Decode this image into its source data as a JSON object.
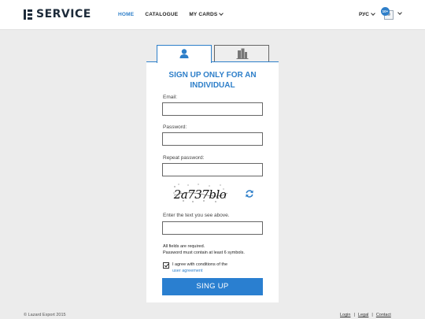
{
  "brand": {
    "name": "SERVICE",
    "logo_icon": "brand-e-logo-icon"
  },
  "nav": {
    "home": "HOME",
    "catalogue": "CATALOGUE",
    "my_cards": "MY CARDS"
  },
  "header": {
    "language": "РУС",
    "user_badge": "10+"
  },
  "tabs": {
    "individual_icon": "person-icon",
    "company_icon": "building-icon"
  },
  "form": {
    "title": "SIGN UP ONLY FOR AN INDIVIDUAL",
    "email_label": "Email:",
    "email_value": "",
    "password_label": "Password:",
    "password_value": "",
    "repeat_password_label": "Repeat password:",
    "repeat_password_value": "",
    "captcha_text": "2a737blo",
    "captcha_input_label": "Enter the text you see above.",
    "captcha_input_value": "",
    "note_line1": "All fields are required.",
    "note_line2": "Password must contain at least 6 symbols.",
    "agree_text": "I agree with conditions of the",
    "agree_link": "user agreement",
    "agree_checked": true,
    "submit_label": "SING UP"
  },
  "footer": {
    "copyright": "© Lazard Export 2015",
    "login": "Login",
    "legal": "Legal",
    "contact": "Contact",
    "separator": "|"
  },
  "colors": {
    "accent": "#2e7fc9",
    "button": "#2a7fd0",
    "brand": "#1d2b3a",
    "background": "#ececec"
  }
}
